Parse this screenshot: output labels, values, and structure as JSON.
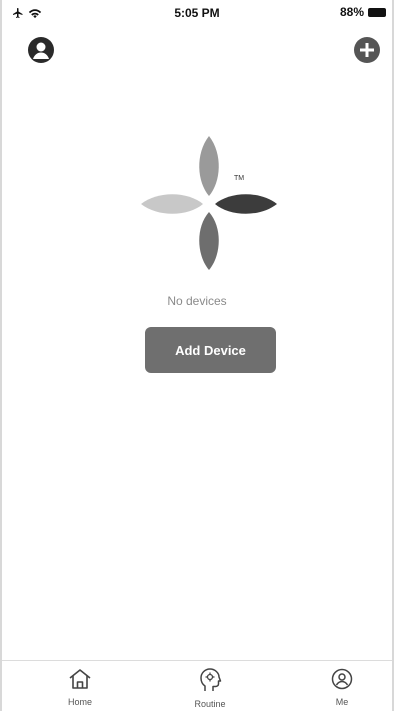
{
  "status_bar": {
    "time": "5:05 PM",
    "battery_percent": "88%",
    "battery_level": 0.88,
    "icons": [
      "airplane-mode-icon",
      "wifi-icon",
      "battery-icon"
    ]
  },
  "header": {
    "left_icon": "profile-icon",
    "right_icon": "add-icon"
  },
  "main": {
    "logo_trademark": "TM",
    "empty_text": "No devices",
    "add_device_label": "Add Device"
  },
  "tabs": [
    {
      "label": "Home",
      "icon": "home-icon"
    },
    {
      "label": "Routine",
      "icon": "routine-icon"
    },
    {
      "label": "Me",
      "icon": "me-icon"
    }
  ],
  "colors": {
    "button_bg": "#6f6f6f",
    "petal_light": "#c8c8c8",
    "petal_mid": "#9a9a9a",
    "petal_dark": "#3c3c3c",
    "petal_lower": "#6e6e6e"
  }
}
